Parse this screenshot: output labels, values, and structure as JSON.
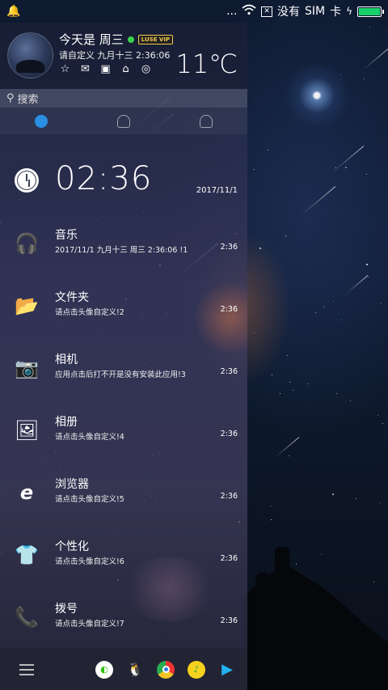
{
  "status_bar": {
    "left_icon": "notification-bell-icon",
    "dots": "...",
    "no_service": "没有",
    "sim": "SIM",
    "card": "卡",
    "battery_level": 1.0,
    "battery_color": "#19d06b"
  },
  "header": {
    "day_text": "今天是 周三",
    "vip_badge": "LUSE VIP",
    "subtitle": "请自定义 九月十三 2:36:06",
    "temperature": "11℃",
    "mini_icons": [
      "star-icon",
      "mail-icon",
      "inbox-icon",
      "store-icon",
      "theme-icon"
    ]
  },
  "search": {
    "placeholder": "搜索"
  },
  "tabs": [
    {
      "name": "messages-tab",
      "active": true
    },
    {
      "name": "contacts-tab",
      "active": false
    },
    {
      "name": "groups-tab",
      "active": false
    }
  ],
  "clock": {
    "time": "02:36",
    "date": "2017/11/1"
  },
  "items": [
    {
      "icon": "headset-icon",
      "title": "音乐",
      "desc": "2017/11/1 九月十三 周三 2:36:06 !1",
      "time": "2:36"
    },
    {
      "icon": "folder-icon",
      "title": "文件夹",
      "desc": "请点击头像自定义!2",
      "time": "2:36"
    },
    {
      "icon": "camera-icon",
      "title": "相机",
      "desc": "应用点击后打不开是没有安装此应用!3",
      "time": "2:36"
    },
    {
      "icon": "photo-album-icon",
      "title": "相册",
      "desc": "请点击头像自定义!4",
      "time": "2:36"
    },
    {
      "icon": "browser-icon",
      "title": "浏览器",
      "desc": "请点击头像自定义!5",
      "time": "2:36"
    },
    {
      "icon": "tshirt-icon",
      "title": "个性化",
      "desc": "请点击头像自定义!6",
      "time": "2:36"
    },
    {
      "icon": "phone-icon",
      "title": "拨号",
      "desc": "请点击头像自定义!7",
      "time": "2:36"
    }
  ],
  "bottom_apps": [
    {
      "name": "wechat-icon",
      "color": "#ffffff"
    },
    {
      "name": "qq-icon",
      "color": "#ffffff"
    },
    {
      "name": "chrome-icon",
      "color": "#ffffff"
    },
    {
      "name": "qq-music-icon",
      "color": "#f7d21d"
    },
    {
      "name": "video-player-icon",
      "color": "#ffffff"
    }
  ]
}
